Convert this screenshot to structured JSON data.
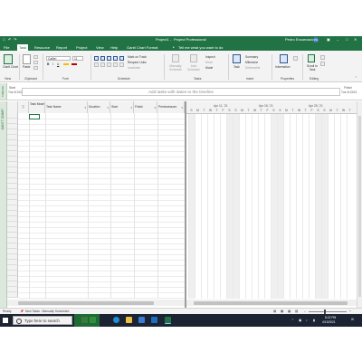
{
  "titlebar": {
    "filename": "Project1",
    "app_name": "Project Professional",
    "user_name": "Pedro Encarnacion",
    "user_initials": "PE"
  },
  "tabs": [
    "File",
    "Task",
    "Resource",
    "Report",
    "Project",
    "View",
    "Help",
    "Gantt Chart Format"
  ],
  "active_tab": "Task",
  "tell_me": "Tell me what you want to do",
  "ribbon": {
    "gantt_chart": "Gantt Chart",
    "paste": "Paste",
    "font_name": "Calibri",
    "font_size": "11",
    "mark_on_track": "Mark on Track",
    "respect_links": "Respect Links",
    "inactivate": "Inactivate",
    "manually_schedule": "Manually Schedule",
    "auto_schedule": "Auto Schedule",
    "inspect": "Inspect",
    "move": "Move",
    "mode": "Mode",
    "task": "Task",
    "summary": "Summary",
    "milestone": "Milestone",
    "deliverable": "Deliverable",
    "information": "Information",
    "scroll_to_task": "Scroll to Task",
    "groups": [
      "View",
      "Clipboard",
      "Font",
      "Schedule",
      "Tasks",
      "Insert",
      "Properties",
      "Editing"
    ]
  },
  "timeline": {
    "side_label": "TIMELINE",
    "start_label": "Start",
    "start_date": "Tue 4/13/21",
    "finish_label": "Finish",
    "finish_date": "Tue 4/13/21",
    "hint": "Add tasks with dates to the timeline"
  },
  "view_label": "GANTT CHART",
  "columns": {
    "task_mode": "Task Mode",
    "task_name": "Task Name",
    "duration": "Duration",
    "start": "Start",
    "finish": "Finish",
    "predecessors": "Predecessors"
  },
  "gantt": {
    "weeks": [
      "Apr 11, '21",
      "Apr 18, '21",
      "Apr 25, '21"
    ],
    "days": [
      "S",
      "M",
      "T",
      "W",
      "T",
      "F",
      "S",
      "S",
      "M",
      "T",
      "W",
      "T",
      "F",
      "S",
      "S",
      "M",
      "T",
      "W",
      "T",
      "F",
      "S",
      "S",
      "M",
      "T",
      "W",
      "T"
    ]
  },
  "status": {
    "ready": "Ready",
    "new_tasks": "New Tasks : Manually Scheduled"
  },
  "taskbar": {
    "search_placeholder": "Type here to search",
    "time": "8:22 PM",
    "date": "4/13/2021"
  },
  "colors": {
    "accent": "#217346",
    "taskbar": "#1c2433",
    "ribbon": "#f3f3f3"
  }
}
